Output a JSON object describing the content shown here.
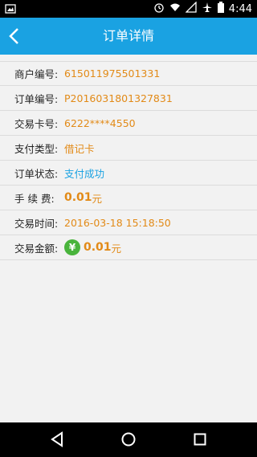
{
  "status_bar": {
    "time": "4:44"
  },
  "header": {
    "title": "订单详情"
  },
  "details": [
    {
      "label": "商户编号:",
      "value": "615011975501331"
    },
    {
      "label": "订单编号:",
      "value": "P2016031801327831"
    },
    {
      "label": "交易卡号:",
      "value": "6222****4550"
    },
    {
      "label": "支付类型:",
      "value": "借记卡"
    },
    {
      "label": "订单状态:",
      "value": "支付成功"
    },
    {
      "label": "手 续 费:",
      "value": "0.01",
      "unit": "元"
    },
    {
      "label": "交易时间:",
      "value": "2016-03-18 15:18:50"
    },
    {
      "label": "交易金额:",
      "value": "0.01",
      "unit": "元",
      "icon_glyph": "¥"
    }
  ],
  "colors": {
    "accent": "#1aa2e2",
    "value": "#e28a17",
    "success_icon": "#49b43c"
  }
}
